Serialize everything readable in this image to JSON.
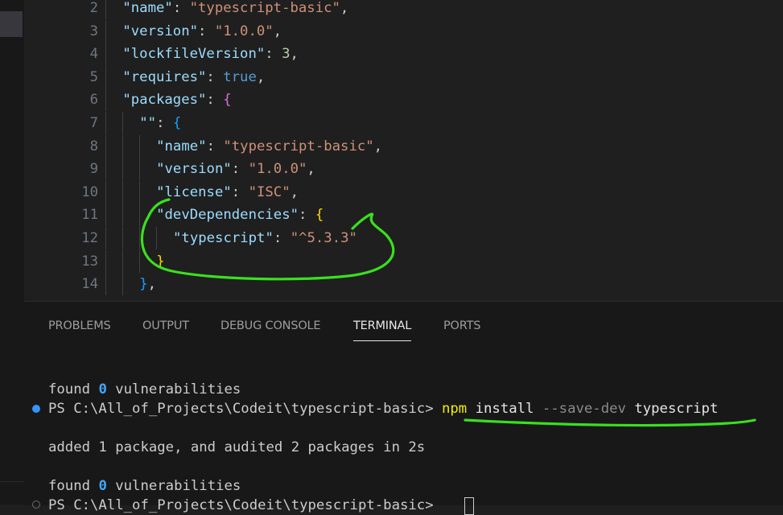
{
  "editor": {
    "lines": [
      {
        "n": "2",
        "parts": [
          {
            "t": "\"name\"",
            "c": "k"
          },
          {
            "t": ": ",
            "c": "p"
          },
          {
            "t": "\"typescript-basic\"",
            "c": "s"
          },
          {
            "t": ",",
            "c": "p"
          }
        ]
      },
      {
        "n": "3",
        "parts": [
          {
            "t": "\"version\"",
            "c": "k"
          },
          {
            "t": ": ",
            "c": "p"
          },
          {
            "t": "\"1.0.0\"",
            "c": "s"
          },
          {
            "t": ",",
            "c": "p"
          }
        ]
      },
      {
        "n": "4",
        "parts": [
          {
            "t": "\"lockfileVersion\"",
            "c": "k"
          },
          {
            "t": ": ",
            "c": "p"
          },
          {
            "t": "3",
            "c": "n"
          },
          {
            "t": ",",
            "c": "p"
          }
        ]
      },
      {
        "n": "5",
        "parts": [
          {
            "t": "\"requires\"",
            "c": "k"
          },
          {
            "t": ": ",
            "c": "p"
          },
          {
            "t": "true",
            "c": "b"
          },
          {
            "t": ",",
            "c": "p"
          }
        ]
      },
      {
        "n": "6",
        "parts": [
          {
            "t": "\"packages\"",
            "c": "k"
          },
          {
            "t": ": ",
            "c": "p"
          },
          {
            "t": "{",
            "c": "br2"
          }
        ]
      },
      {
        "n": "7",
        "parts": [
          {
            "t": "\"\"",
            "c": "k"
          },
          {
            "t": ": ",
            "c": "p"
          },
          {
            "t": "{",
            "c": "br3"
          }
        ]
      },
      {
        "n": "8",
        "parts": [
          {
            "t": "\"name\"",
            "c": "k"
          },
          {
            "t": ": ",
            "c": "p"
          },
          {
            "t": "\"typescript-basic\"",
            "c": "s"
          },
          {
            "t": ",",
            "c": "p"
          }
        ]
      },
      {
        "n": "9",
        "parts": [
          {
            "t": "\"version\"",
            "c": "k"
          },
          {
            "t": ": ",
            "c": "p"
          },
          {
            "t": "\"1.0.0\"",
            "c": "s"
          },
          {
            "t": ",",
            "c": "p"
          }
        ]
      },
      {
        "n": "10",
        "parts": [
          {
            "t": "\"license\"",
            "c": "k"
          },
          {
            "t": ": ",
            "c": "p"
          },
          {
            "t": "\"ISC\"",
            "c": "s"
          },
          {
            "t": ",",
            "c": "p"
          }
        ]
      },
      {
        "n": "11",
        "parts": [
          {
            "t": "\"devDependencies\"",
            "c": "k"
          },
          {
            "t": ": ",
            "c": "p"
          },
          {
            "t": "{",
            "c": "br1"
          }
        ]
      },
      {
        "n": "12",
        "parts": [
          {
            "t": "\"typescript\"",
            "c": "k"
          },
          {
            "t": ": ",
            "c": "p"
          },
          {
            "t": "\"^5.3.3\"",
            "c": "s"
          }
        ]
      },
      {
        "n": "13",
        "parts": [
          {
            "t": "}",
            "c": "br1"
          }
        ]
      },
      {
        "n": "14",
        "parts": [
          {
            "t": "}",
            "c": "br3"
          },
          {
            "t": ",",
            "c": "p"
          }
        ]
      }
    ]
  },
  "panel": {
    "tabs": [
      {
        "label": "PROBLEMS",
        "active": false
      },
      {
        "label": "OUTPUT",
        "active": false
      },
      {
        "label": "DEBUG CONSOLE",
        "active": false
      },
      {
        "label": "TERMINAL",
        "active": true
      },
      {
        "label": "PORTS",
        "active": false
      }
    ]
  },
  "terminal": {
    "found1": {
      "pre": "found ",
      "num": "0",
      "post": " vulnerabilities"
    },
    "prompt1": {
      "path": "PS C:\\All_of_Projects\\Codeit\\typescript-basic> ",
      "cmd": "npm",
      "arg1": "install",
      "flag": "--save-dev",
      "arg2": "typescript"
    },
    "added": "added 1 package, and audited 2 packages in 2s",
    "found2": {
      "pre": "found ",
      "num": "0",
      "post": " vulnerabilities"
    },
    "prompt2": {
      "path": "PS C:\\All_of_Projects\\Codeit\\typescript-basic> "
    }
  },
  "colors": {
    "annotation": "#39e01e",
    "accent": "#3794ff"
  }
}
